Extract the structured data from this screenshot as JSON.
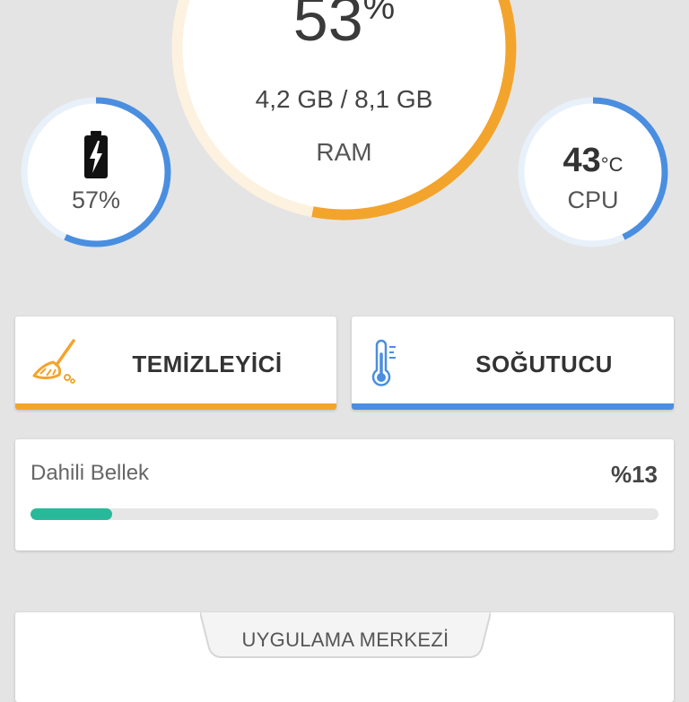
{
  "ram": {
    "percent_number": "53",
    "percent_symbol": "%",
    "usage": "4,2 GB / 8,1 GB",
    "label": "RAM",
    "fraction": 0.53
  },
  "battery": {
    "value": "57%",
    "fraction": 0.57,
    "icon": "battery-charging-icon"
  },
  "cpu": {
    "temp_number": "43",
    "temp_unit": "°C",
    "label": "CPU",
    "fraction": 0.43
  },
  "actions": {
    "cleaner_label": "TEMİZLEYİCİ",
    "cleaner_icon": "broom-icon",
    "cooler_label": "SOĞUTUCU",
    "cooler_icon": "thermometer-icon"
  },
  "storage": {
    "title": "Dahili Bellek",
    "percent": "%13",
    "fraction": 0.13
  },
  "app_center": {
    "title": "UYGULAMA MERKEZİ"
  },
  "colors": {
    "orange": "#f3a42c",
    "blue": "#4a8ee0",
    "teal": "#27b99a",
    "track_light_orange": "#fdf2e0",
    "track_light_blue": "#e8f0fa"
  }
}
